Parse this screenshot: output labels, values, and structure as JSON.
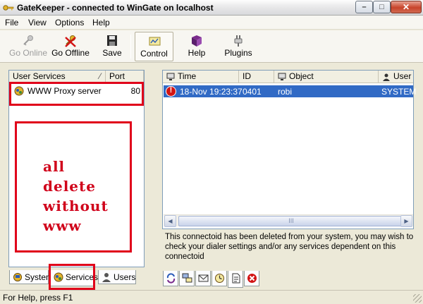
{
  "window": {
    "title": "GateKeeper - connected to WinGate on localhost",
    "controls": {
      "minimize": "–",
      "maximize": "□",
      "close": "✕"
    }
  },
  "menu": [
    "File",
    "View",
    "Options",
    "Help"
  ],
  "toolbar": {
    "go_online": "Go Online",
    "go_offline": "Go Offline",
    "save": "Save",
    "control": "Control",
    "help": "Help",
    "plugins": "Plugins"
  },
  "services_panel": {
    "col_name": "User Services",
    "col_port": "Port",
    "rows": [
      {
        "name": "WWW Proxy server",
        "port": "80"
      }
    ],
    "annotation": [
      "all",
      "delete",
      "without",
      "www"
    ]
  },
  "left_tabs": {
    "system": "System",
    "services": "Services",
    "users": "Users"
  },
  "activity_panel": {
    "columns": [
      "Time",
      "ID",
      "Object",
      "User"
    ],
    "rows": [
      {
        "time": "18-Nov 19:23:37",
        "id": "0401",
        "object": "robi",
        "user": "SYSTEM"
      }
    ],
    "scroll_grip": "III",
    "message": "This connectoid has been deleted from your system, you may wish to check your dialer settings and/or any services dependent on this connectoid"
  },
  "right_tabs": [
    "refresh-icon",
    "network-icon",
    "mail-icon",
    "clock-icon",
    "document-icon",
    "error-icon"
  ],
  "status": {
    "text": "For Help, press F1"
  },
  "colors": {
    "annotation_red": "#e0001a",
    "selection_blue": "#316ac5",
    "error_red": "#d21414"
  }
}
